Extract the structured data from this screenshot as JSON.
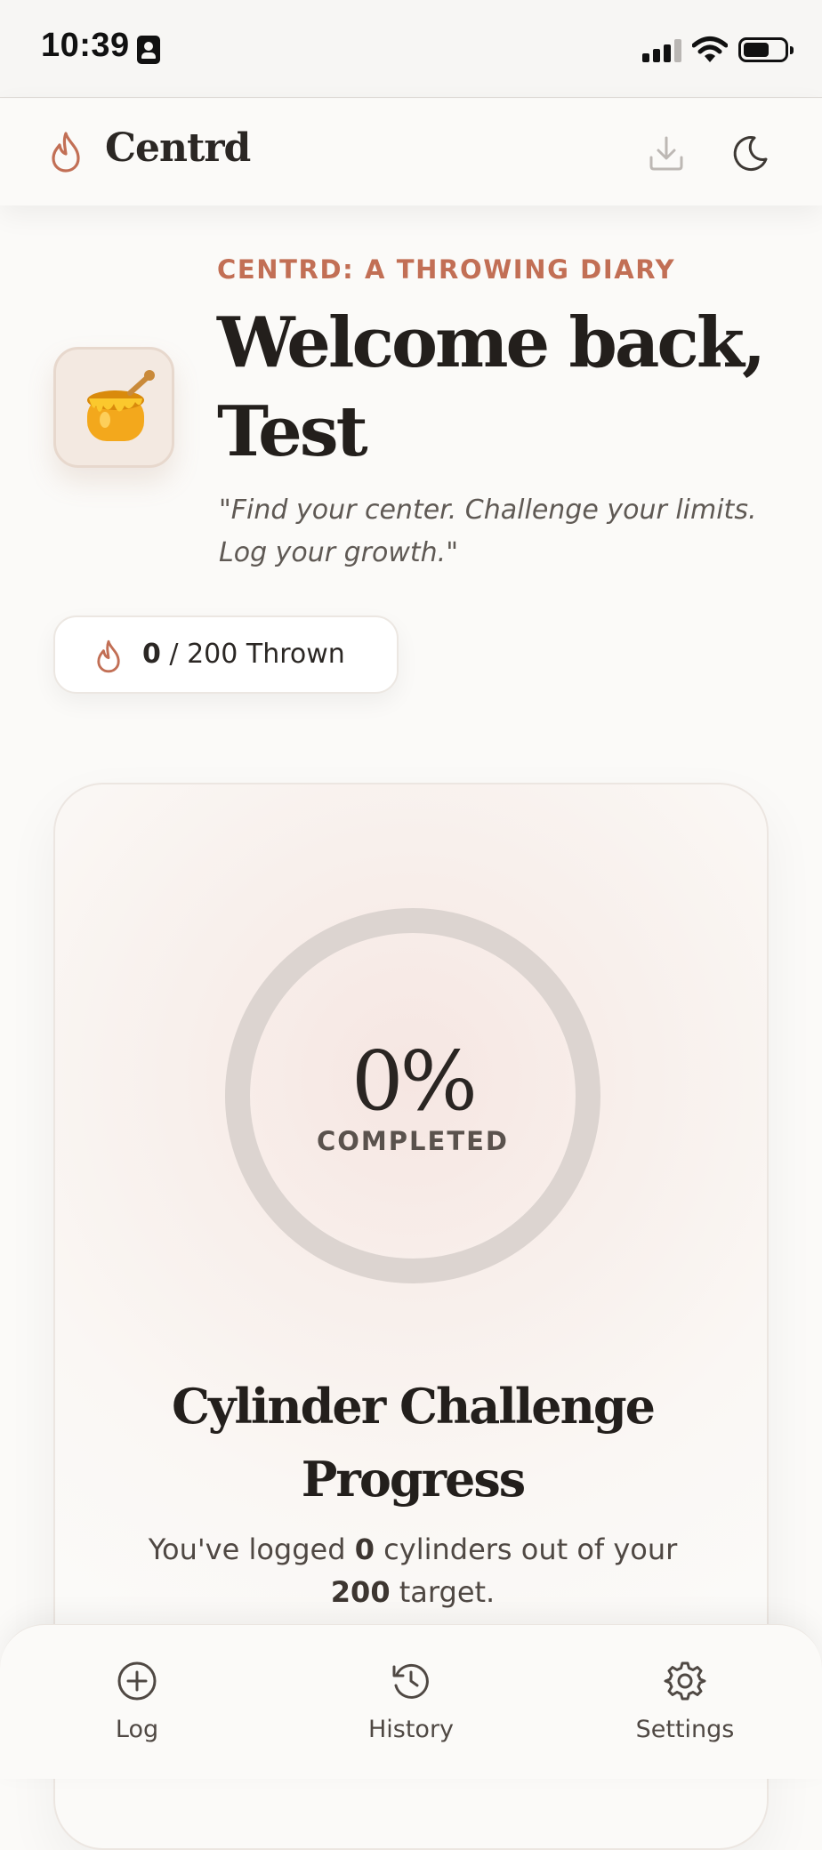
{
  "status_bar": {
    "time": "10:39"
  },
  "header": {
    "brand": "Centrd",
    "icons": [
      "flame-icon",
      "download-icon",
      "moon-icon"
    ]
  },
  "hero": {
    "kicker": "CENTRD: A THROWING DIARY",
    "welcome": "Welcome back, Test",
    "tagline": "\"Find your center. Challenge your limits. Log your growth.\"",
    "avatar_emoji": "🍯"
  },
  "thrown": {
    "count": "0",
    "rest": "/ 200 Thrown",
    "progress_fraction": 0
  },
  "progress_card": {
    "percent": "0%",
    "percent_label": "COMPLETED",
    "title": "Cylinder Challenge Progress",
    "desc_prefix": "You've logged ",
    "logged": "0",
    "desc_middle": " cylinders out of your ",
    "target": "200",
    "desc_suffix": " target."
  },
  "nav": {
    "log": "Log",
    "history": "History",
    "settings": "Settings"
  },
  "colors": {
    "accent": "#c26f55",
    "text": "#2b2724",
    "background": "#fbfaf8",
    "ring": "#dcd4d0"
  }
}
